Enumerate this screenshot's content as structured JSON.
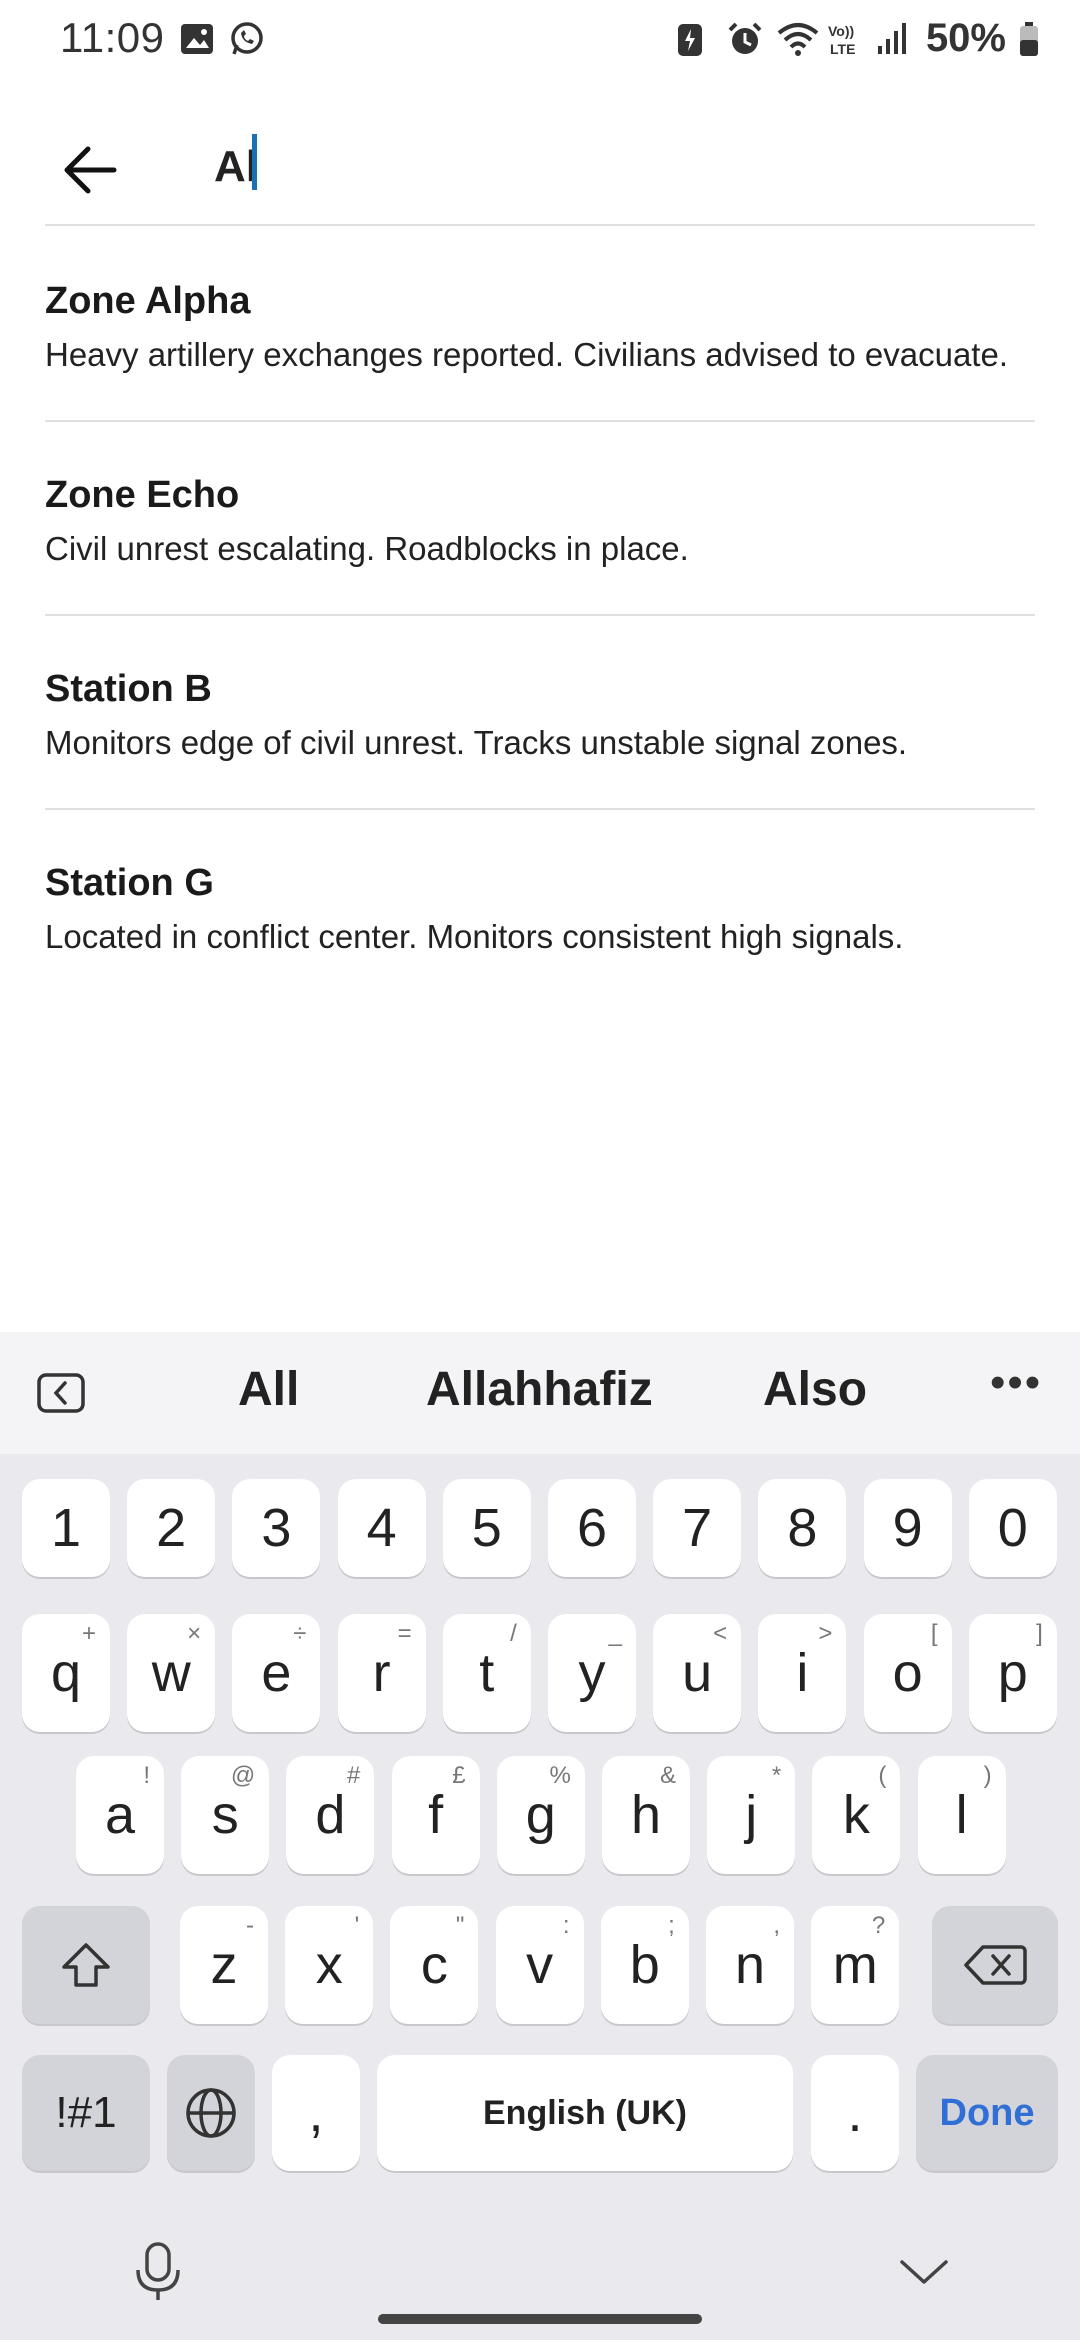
{
  "status_bar": {
    "time": "11:09",
    "battery": "50%"
  },
  "search": {
    "value": "Al"
  },
  "results": [
    {
      "title": "Zone Alpha",
      "description": "Heavy artillery exchanges reported. Civilians advised to evacuate."
    },
    {
      "title": "Zone Echo",
      "description": "Civil unrest escalating. Roadblocks in place."
    },
    {
      "title": "Station B",
      "description": "Monitors edge of civil unrest. Tracks unstable signal zones."
    },
    {
      "title": "Station G",
      "description": "Located in conflict center. Monitors consistent high signals."
    }
  ],
  "keyboard": {
    "suggestions": [
      "All",
      "Allahhafiz",
      "Also"
    ],
    "numbers": [
      "1",
      "2",
      "3",
      "4",
      "5",
      "6",
      "7",
      "8",
      "9",
      "0"
    ],
    "row1": [
      {
        "key": "q",
        "alt": "+"
      },
      {
        "key": "w",
        "alt": "×"
      },
      {
        "key": "e",
        "alt": "÷"
      },
      {
        "key": "r",
        "alt": "="
      },
      {
        "key": "t",
        "alt": "/"
      },
      {
        "key": "y",
        "alt": "_"
      },
      {
        "key": "u",
        "alt": "<"
      },
      {
        "key": "i",
        "alt": ">"
      },
      {
        "key": "o",
        "alt": "["
      },
      {
        "key": "p",
        "alt": "]"
      }
    ],
    "row2": [
      {
        "key": "a",
        "alt": "!"
      },
      {
        "key": "s",
        "alt": "@"
      },
      {
        "key": "d",
        "alt": "#"
      },
      {
        "key": "f",
        "alt": "£"
      },
      {
        "key": "g",
        "alt": "%"
      },
      {
        "key": "h",
        "alt": "&"
      },
      {
        "key": "j",
        "alt": "*"
      },
      {
        "key": "k",
        "alt": "("
      },
      {
        "key": "l",
        "alt": ")"
      }
    ],
    "row3": [
      {
        "key": "z",
        "alt": "-"
      },
      {
        "key": "x",
        "alt": "'"
      },
      {
        "key": "c",
        "alt": "\""
      },
      {
        "key": "v",
        "alt": ":"
      },
      {
        "key": "b",
        "alt": ";"
      },
      {
        "key": "n",
        "alt": ","
      },
      {
        "key": "m",
        "alt": "?"
      }
    ],
    "symbols_label": "!#1",
    "comma": ",",
    "space_label": "English (UK)",
    "period": ".",
    "done_label": "Done"
  }
}
